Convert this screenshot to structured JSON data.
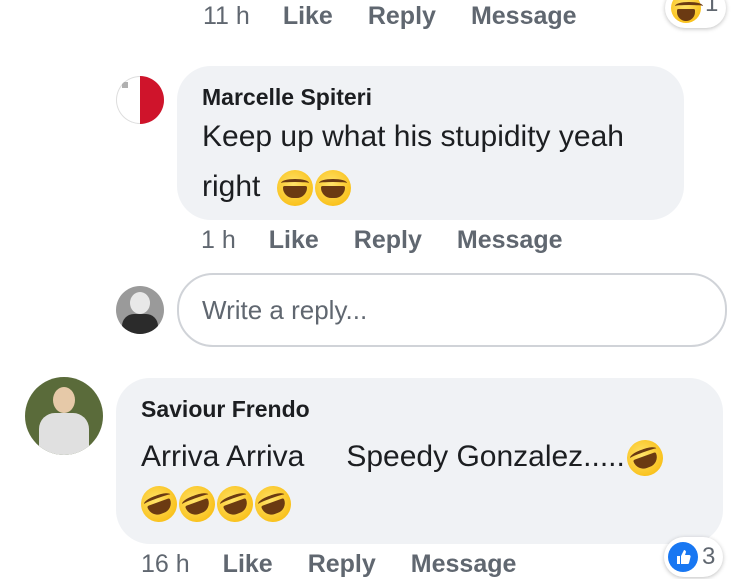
{
  "top_meta": {
    "time": "11 h",
    "like": "Like",
    "reply": "Reply",
    "message": "Message"
  },
  "top_reaction": {
    "icon": "haha-emoji-icon",
    "count": "1"
  },
  "comment1": {
    "author": "Marcelle Spiteri",
    "text_line1": "Keep up what his stupidity yeah",
    "text_line2": "right",
    "emojis": [
      "laugh-tears-emoji-icon",
      "laugh-tears-emoji-icon"
    ],
    "time": "1 h",
    "like": "Like",
    "reply": "Reply",
    "message": "Message"
  },
  "reply_box": {
    "placeholder": "Write a reply..."
  },
  "comment2": {
    "author": "Saviour Frendo",
    "text_line1a": "Arriva Arriva",
    "text_line1b": "Speedy Gonzalez.....",
    "emojis": [
      "rofl-emoji-icon",
      "rofl-emoji-icon",
      "rofl-emoji-icon",
      "rofl-emoji-icon",
      "rofl-emoji-icon"
    ],
    "time": "16 h",
    "like": "Like",
    "reply": "Reply",
    "message": "Message",
    "reaction": {
      "icon": "like-thumb-icon",
      "count": "3",
      "color": "#1877f2"
    }
  }
}
